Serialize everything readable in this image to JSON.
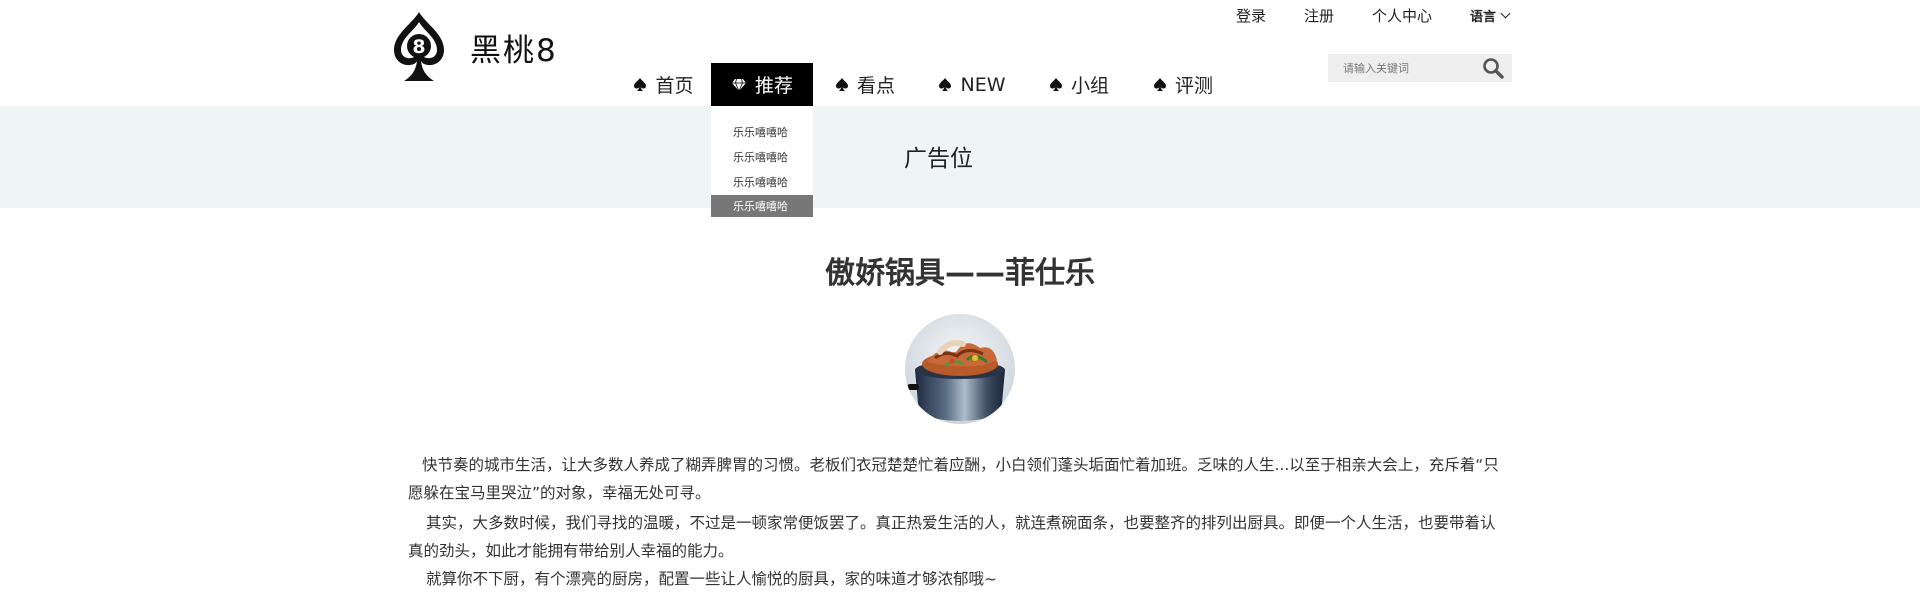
{
  "brand": {
    "name": "黑桃8",
    "logo_mark": "8",
    "logo_icon": "spade-logo-icon"
  },
  "topbar": {
    "links": [
      "登录",
      "注册",
      "个人中心"
    ],
    "language_label": "语言"
  },
  "nav": {
    "items": [
      {
        "label": "首页",
        "icon": "spade-icon"
      },
      {
        "label": "推荐",
        "icon": "diamond-icon",
        "active": true
      },
      {
        "label": "看点",
        "icon": "spade-icon"
      },
      {
        "label": "NEW",
        "icon": "spade-icon"
      },
      {
        "label": "小组",
        "icon": "spade-icon"
      },
      {
        "label": "评测",
        "icon": "spade-icon"
      }
    ],
    "dropdown": [
      "乐乐嘻嘻哈",
      "乐乐嘻嘻哈",
      "乐乐嘻嘻哈",
      "乐乐嘻嘻哈"
    ]
  },
  "search": {
    "placeholder": "请输入关键词",
    "icon": "search-icon"
  },
  "ad": {
    "label": "广告位"
  },
  "article": {
    "title": "傲娇锅具——菲仕乐",
    "paragraphs": [
      "快节奏的城市生活，让大多数人养成了糊弄脾胃的习惯。老板们衣冠楚楚忙着应酬，小白领们蓬头垢面忙着加班。乏味的人生...以至于相亲大会上，充斥着“只愿躲在宝马里哭泣”的对象，幸福无处可寻。",
      "其实，大多数时候，我们寻找的温暖，不过是一顿家常便饭罢了。真正热爱生活的人，就连煮碗面条，也要整齐的排列出厨具。即便一个人生活，也要带着认真的劲头，如此才能拥有带给别人幸福的能力。",
      "就算你不下厨，有个漂亮的厨房，配置一些让人愉悦的厨具，家的味道才够浓郁哦~"
    ]
  },
  "colors": {
    "nav_active_bg": "#000000",
    "ad_bg": "#eff4f4",
    "dropdown_highlight": "#777777",
    "search_bg": "#eeeeee"
  }
}
